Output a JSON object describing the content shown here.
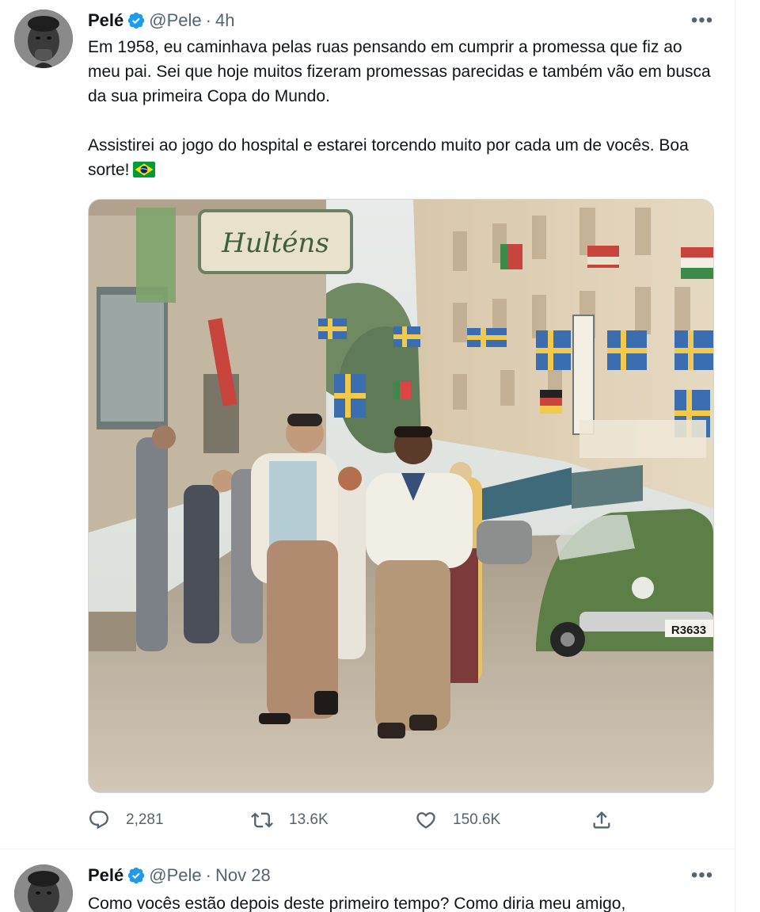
{
  "tweets": [
    {
      "author": {
        "display_name": "Pelé",
        "handle": "@Pele",
        "avatar_icon": "avatar-photo-icon",
        "verified_icon": "verified-badge-icon"
      },
      "time": "4h",
      "text": {
        "paragraph1": "Em 1958, eu caminhava pelas ruas pensando em cumprir a promessa que fiz ao meu pai. Sei que hoje muitos fizeram promessas parecidas e também vão em busca da sua primeira Copa do Mundo.",
        "paragraph2": "Assistirei ao jogo do hospital e estarei torcendo muito por cada um de vocês. Boa sorte!",
        "emoji_icon": "brazil-flag-icon"
      },
      "media": {
        "sign_text": "Hulténs",
        "car_plate": "R3633"
      },
      "actions": {
        "replies": "2,281",
        "retweets": "13.6K",
        "likes": "150.6K"
      }
    },
    {
      "author": {
        "display_name": "Pelé",
        "handle": "@Pele"
      },
      "time": "Nov 28",
      "text": {
        "paragraph1": "Como vocês estão depois deste primeiro tempo? Como diria meu amigo,"
      }
    }
  ],
  "colors": {
    "text_primary": "#0f1419",
    "text_secondary": "#536471",
    "verified_blue": "#1d9bf0",
    "divider": "#eff3f4"
  }
}
